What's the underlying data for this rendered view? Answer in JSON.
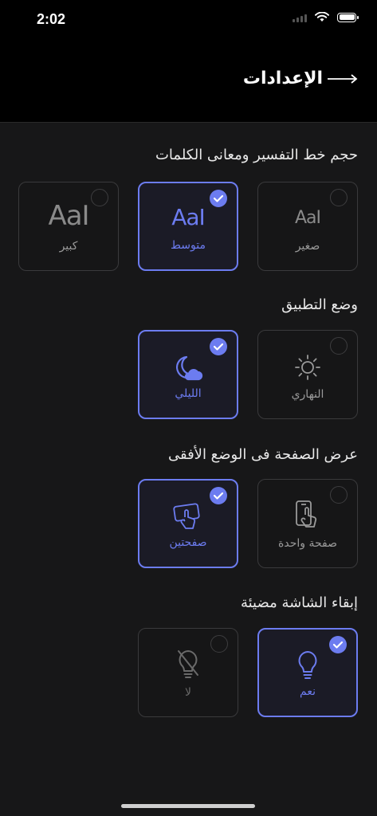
{
  "status": {
    "time": "2:02"
  },
  "header": {
    "title": "الإعدادات"
  },
  "sections": {
    "font_size": {
      "title": "حجم خط التفسير ومعانى الكلمات",
      "options": [
        {
          "glyph": "Aa",
          "label": "صغير"
        },
        {
          "glyph": "Aa",
          "label": "متوسط"
        },
        {
          "glyph": "Aa",
          "label": "كبير"
        }
      ]
    },
    "app_mode": {
      "title": "وضع التطبيق",
      "options": [
        {
          "label": "النهاري"
        },
        {
          "label": "الليلي"
        }
      ]
    },
    "landscape": {
      "title": "عرض الصفحة فى الوضع الأفقى",
      "options": [
        {
          "label": "صفحة واحدة"
        },
        {
          "label": "صفحتين"
        }
      ]
    },
    "keep_awake": {
      "title": "إبقاء الشاشة مضيئة",
      "options": [
        {
          "label": "نعم"
        },
        {
          "label": "لا"
        }
      ]
    }
  },
  "colors": {
    "accent": "#6c7cf0",
    "background": "#171718",
    "header": "#000000"
  }
}
